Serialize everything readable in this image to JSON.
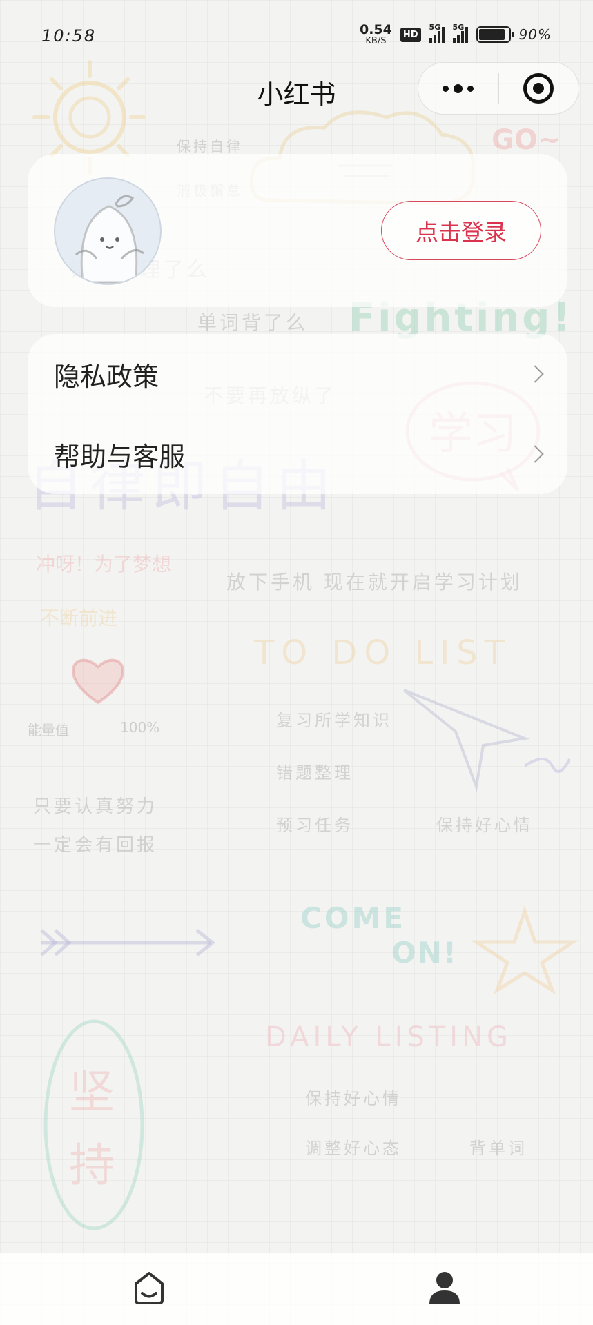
{
  "status_bar": {
    "time": "10:58",
    "net_speed_value": "0.54",
    "net_speed_unit": "KB/S",
    "hd_badge": "HD",
    "signal_1_label": "5G",
    "signal_2_label": "5G",
    "battery_text": "90%",
    "battery_level": 0.9
  },
  "nav": {
    "title": "小红书",
    "more_icon": "more-dots-icon",
    "close_icon": "target-circle-icon"
  },
  "profile": {
    "avatar_icon": "cartoon-mascot-avatar",
    "login_label": "点击登录",
    "accent_color": "#d9334d"
  },
  "menu": {
    "items": [
      {
        "label": "隐私政策",
        "icon": "chevron-right-icon"
      },
      {
        "label": "帮助与客服",
        "icon": "chevron-right-icon"
      }
    ]
  },
  "background": {
    "texts": [
      "保持自律",
      "消极懈怠",
      "错题整理了么",
      "单词背了么",
      "Fighting!",
      "不要再放纵了",
      "学习",
      "自律即自由",
      "冲呀！为了梦想",
      "不断前进",
      "放下手机 现在就开启学习计划",
      "TO DO LIST",
      "复习所学知识",
      "错题整理",
      "预习任务",
      "保持好心情",
      "能量值",
      "100%",
      "只要认真努力",
      "一定会有回报",
      "COME",
      "ON!",
      "DAILY LISTING",
      "保持好心情",
      "调整好心态",
      "背单词",
      "坚持",
      "GO~"
    ]
  },
  "tabbar": {
    "tabs": [
      {
        "icon": "home-face-icon"
      },
      {
        "icon": "user-person-icon"
      }
    ]
  }
}
